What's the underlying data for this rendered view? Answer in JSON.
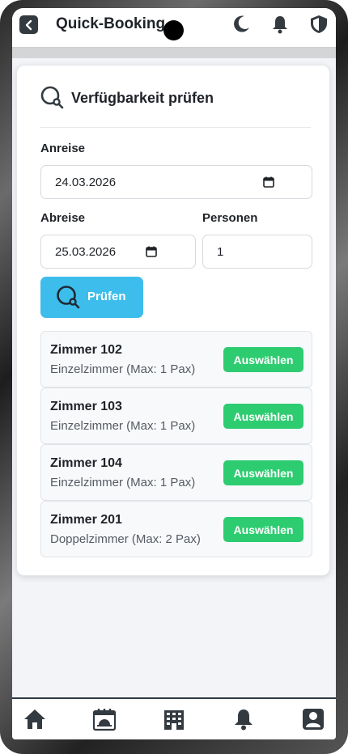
{
  "header": {
    "title": "Quick-Booking",
    "icons": [
      "back-icon",
      "moon-icon",
      "bell-icon",
      "shield-icon"
    ]
  },
  "availability": {
    "title": "Verfügbarkeit prüfen",
    "arrival_label": "Anreise",
    "arrival_value": "24.03.2026",
    "departure_label": "Abreise",
    "departure_value": "25.03.2026",
    "persons_label": "Personen",
    "persons_value": "1",
    "check_button": "Prüfen"
  },
  "rooms": [
    {
      "name": "Zimmer 102",
      "type": "Einzelzimmer (Max: 1 Pax)",
      "action": "Auswählen"
    },
    {
      "name": "Zimmer 103",
      "type": "Einzelzimmer (Max: 1 Pax)",
      "action": "Auswählen"
    },
    {
      "name": "Zimmer 104",
      "type": "Einzelzimmer (Max: 1 Pax)",
      "action": "Auswählen"
    },
    {
      "name": "Zimmer 201",
      "type": "Doppelzimmer (Max: 2 Pax)",
      "action": "Auswählen"
    }
  ],
  "bottom_nav": [
    "home-icon",
    "calendar-service-icon",
    "hotel-building-icon",
    "bell-icon",
    "user-icon"
  ],
  "colors": {
    "accent_blue": "#3dbdeb",
    "select_green": "#2ecc71",
    "text_dark": "#1f2328"
  }
}
